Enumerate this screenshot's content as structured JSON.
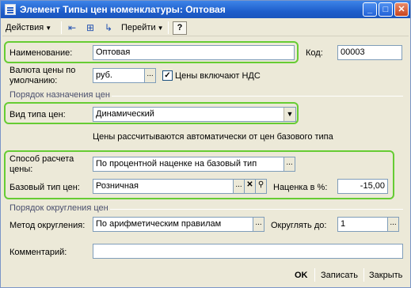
{
  "window": {
    "title": "Элемент Типы цен номенклатуры: Оптовая",
    "controls": {
      "minimize": "_",
      "maximize": "□",
      "close": "✕"
    }
  },
  "toolbar": {
    "actions_label": "Действия",
    "goto_label": "Перейти",
    "help_label": "?"
  },
  "form": {
    "name_label": "Наименование:",
    "name_value": "Оптовая",
    "code_label": "Код:",
    "code_value": "00003",
    "currency_label_line1": "Валюта цены по",
    "currency_label_line2": "умолчанию:",
    "currency_value": "руб.",
    "vat_checkbox_label": "Цены включают НДС",
    "vat_checked": true,
    "section_purpose": "Порядок назначения цен",
    "price_kind_label": "Вид типа цен:",
    "price_kind_value": "Динамический",
    "auto_info": "Цены рассчитываются автоматически от цен базового типа",
    "calc_method_label_line1": "Способ расчета",
    "calc_method_label_line2": "цены:",
    "calc_method_value": "По процентной наценке на базовый тип",
    "base_type_label": "Базовый тип цен:",
    "base_type_value": "Розничная",
    "markup_label": "Наценка в %:",
    "markup_value": "-15,00",
    "section_rounding": "Порядок округления цен",
    "rounding_method_label": "Метод округления:",
    "rounding_method_value": "По арифметическим правилам",
    "round_to_label": "Округлять до:",
    "round_to_value": "1",
    "comment_label": "Комментарий:",
    "comment_value": ""
  },
  "footer": {
    "ok_label": "OK",
    "save_label": "Записать",
    "close_label": "Закрыть"
  },
  "colors": {
    "highlight": "#66cc33",
    "titlebar": "#1f5fcc",
    "window_bg": "#ece9d8"
  }
}
